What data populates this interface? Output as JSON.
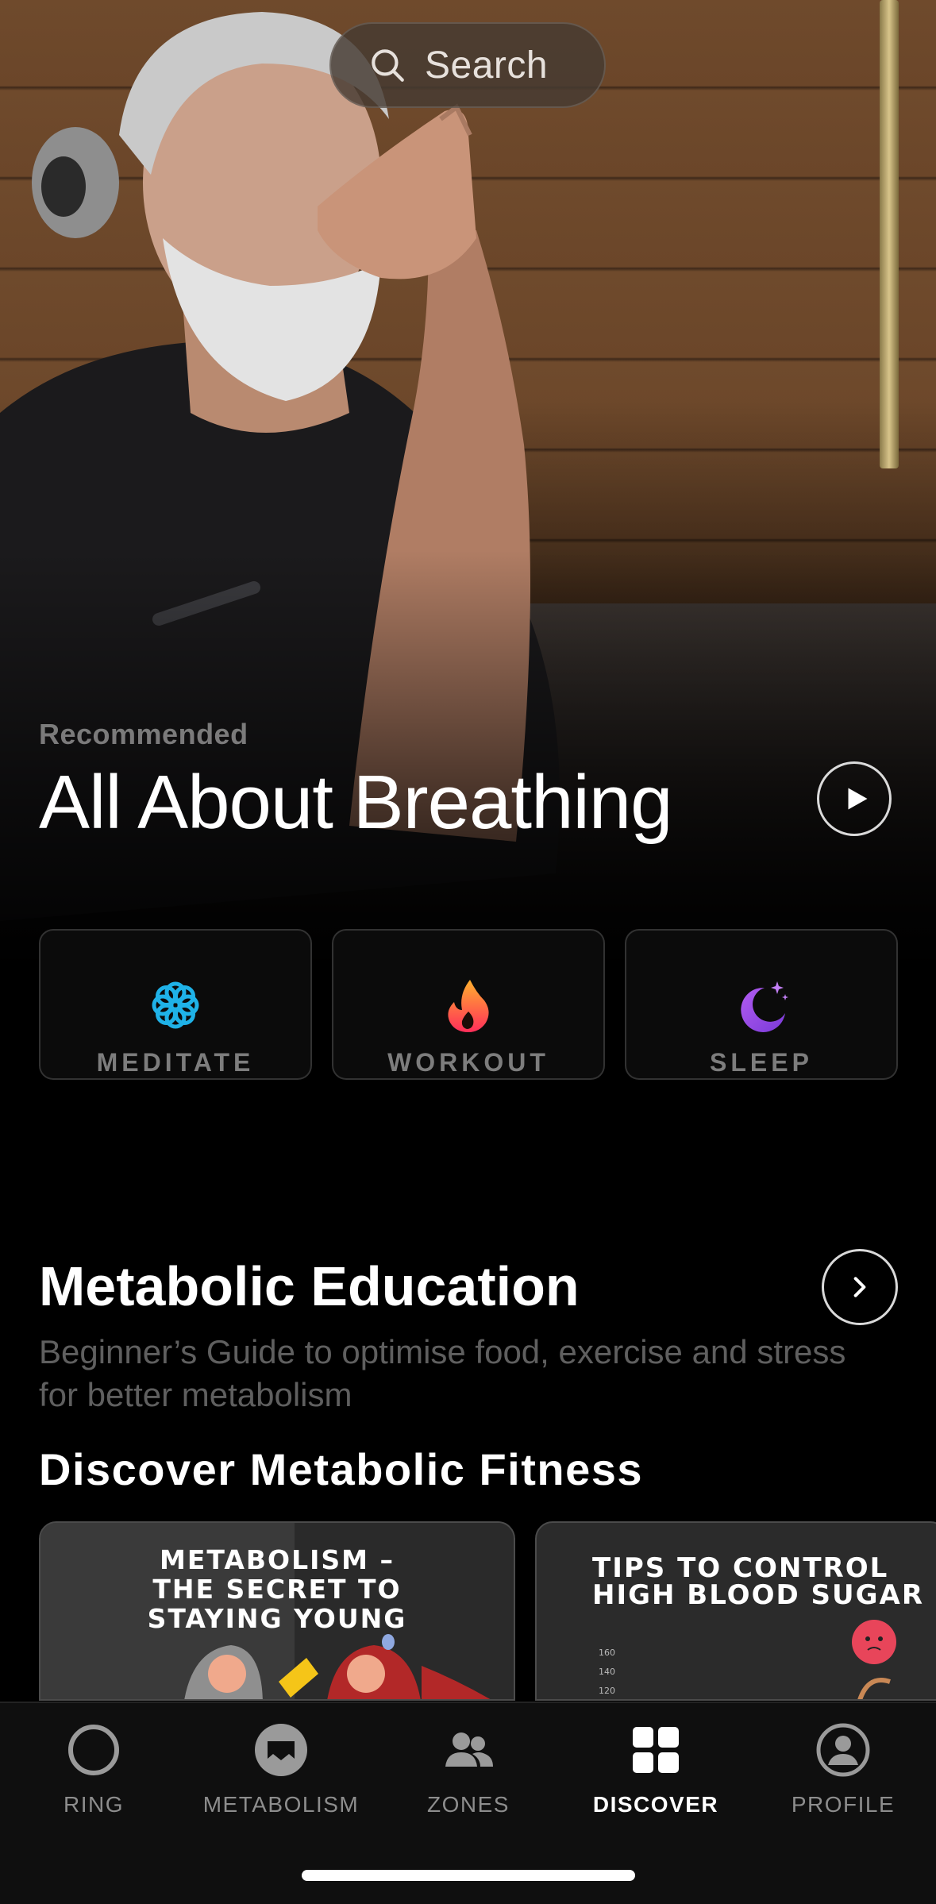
{
  "search": {
    "label": "Search"
  },
  "recommended": {
    "kicker": "Recommended",
    "title": "All About Breathing"
  },
  "categories": [
    {
      "label": "MEDITATE",
      "icon": "meditate-flower-icon",
      "color": "#1fb2e8"
    },
    {
      "label": "WORKOUT",
      "icon": "flame-icon",
      "color": "#ff5a2e"
    },
    {
      "label": "SLEEP",
      "icon": "moon-stars-icon",
      "color": "#9a4ee6"
    }
  ],
  "metabolic_education": {
    "title": "Metabolic Education",
    "description": "Beginner’s Guide to optimise food, exercise and stress for better metabolism"
  },
  "discover": {
    "title": "Discover Metabolic Fitness",
    "cards": [
      {
        "title": "METABOLISM –\nTHE SECRET TO\nSTAYING YOUNG"
      },
      {
        "title": "TIPS TO CONTROL\nHIGH BLOOD SUGAR",
        "chart_labels": [
          "160",
          "140",
          "120"
        ]
      }
    ]
  },
  "tabs": [
    {
      "label": "RING",
      "icon": "ring-icon",
      "active": false
    },
    {
      "label": "METABOLISM",
      "icon": "metabolism-icon",
      "active": false
    },
    {
      "label": "ZONES",
      "icon": "zones-people-icon",
      "active": false
    },
    {
      "label": "DISCOVER",
      "icon": "grid-icon",
      "active": true
    },
    {
      "label": "PROFILE",
      "icon": "profile-icon",
      "active": false
    }
  ]
}
